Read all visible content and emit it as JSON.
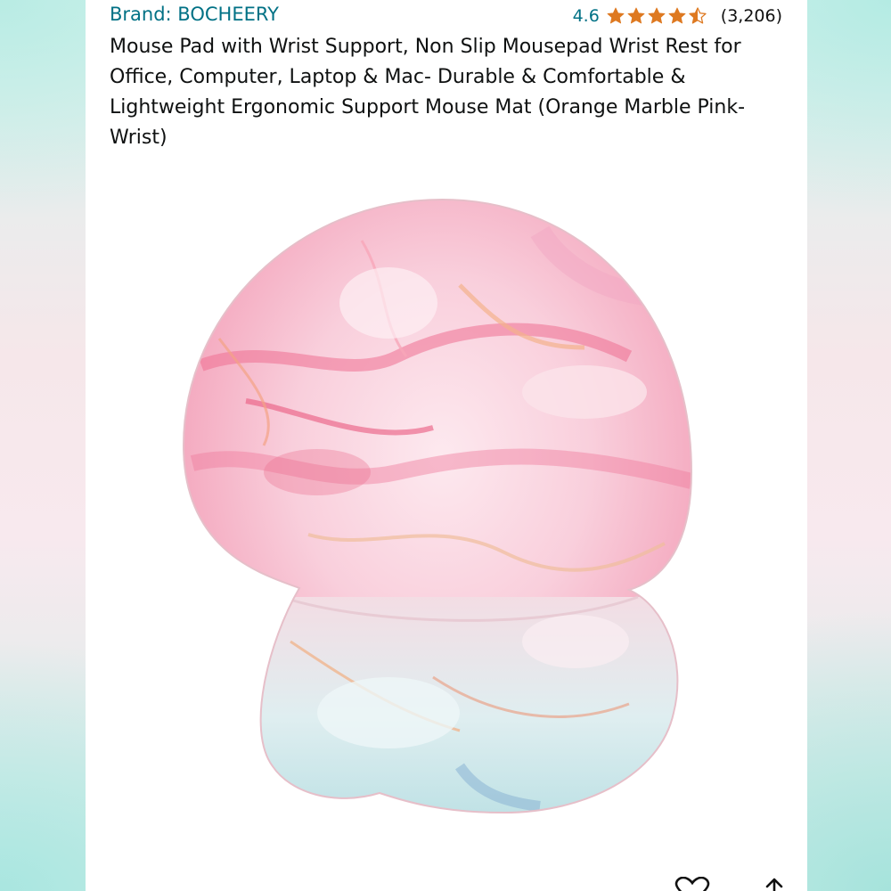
{
  "product": {
    "brand": "Brand: BOCHEERY",
    "rating_value": "4.6",
    "rating_fraction": 0.92,
    "rating_count": "(3,206)",
    "title": "Mouse Pad with Wrist Support, Non Slip Mousepad Wrist Rest for Office, Computer, Laptop & Mac- Durable & Comfortable & Lightweight Ergonomic Support Mouse Mat (Orange Marble Pink-Wrist)"
  },
  "colors": {
    "link": "#007185",
    "star": "#de7921",
    "text": "#0f1111"
  },
  "icons": {
    "stars": [
      "star-full-icon",
      "star-full-icon",
      "star-full-icon",
      "star-full-icon",
      "star-half-icon"
    ],
    "actions": [
      "heart-icon",
      "share-icon"
    ]
  }
}
